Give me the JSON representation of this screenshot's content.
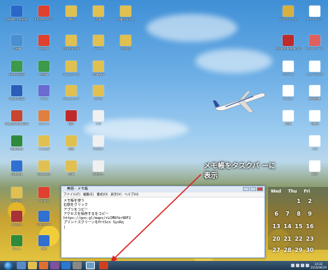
{
  "notepad": {
    "title": "無題 - メモ帳",
    "menu": [
      "ファイル(F)",
      "編集(E)",
      "書式(O)",
      "表示(V)",
      "ヘルプ(H)"
    ],
    "lines": [
      "メモ帳を使う",
      "右側をクリック",
      "アプリをコピー",
      "アクセスを保存するをコピー",
      "https://goo.gl/maps/rLCMRfbr9RF2",
      "プリントスクリーンをPrtScn SysRq",
      "|"
    ]
  },
  "callout": {
    "line1": "メモ帳をタスクバ ーに",
    "line2": "表示"
  },
  "calendar": {
    "headers": [
      "Wed",
      "Thu",
      "Fri"
    ],
    "days": [
      "1",
      "2",
      "6",
      "7",
      "8",
      "9",
      "13",
      "14",
      "15",
      "16",
      "20",
      "21",
      "22",
      "23",
      "27",
      "28",
      "29",
      "30"
    ]
  },
  "icons_left": [
    {
      "label": "Google Chrome",
      "color": "#2b66c9"
    },
    {
      "label": "ごみ箱",
      "color": "#4a8fd0"
    },
    {
      "label": "PDF ファイル",
      "color": "#3d9a4a"
    },
    {
      "label": "デスクトップ",
      "color": "#3d9a4a"
    },
    {
      "label": "PowerPoint 2013",
      "color": "#c9452f"
    },
    {
      "label": "Excel 2013",
      "color": "#2f8a3d"
    },
    {
      "label": "Word 2013",
      "color": "#2b5eb8"
    },
    {
      "label": "Outlook",
      "color": "#3070d0"
    },
    {
      "label": "Access",
      "color": "#a83238"
    }
  ],
  "icons_right": [
    {
      "label": "デスクトップ",
      "color": "#d8b040"
    },
    {
      "label": "Acrobat Reader DC",
      "color": "#c02a2a"
    },
    {
      "label": "ネットワーク",
      "color": "#e06060"
    },
    {
      "label": "ドキュメント",
      "color": "#ffffff"
    },
    {
      "label": "ピクチャ",
      "color": "#ffffff"
    },
    {
      "label": "ミュージック",
      "color": "#ffffff"
    }
  ],
  "taskbar": {
    "time": "14:32",
    "date": "2016/06/29"
  }
}
